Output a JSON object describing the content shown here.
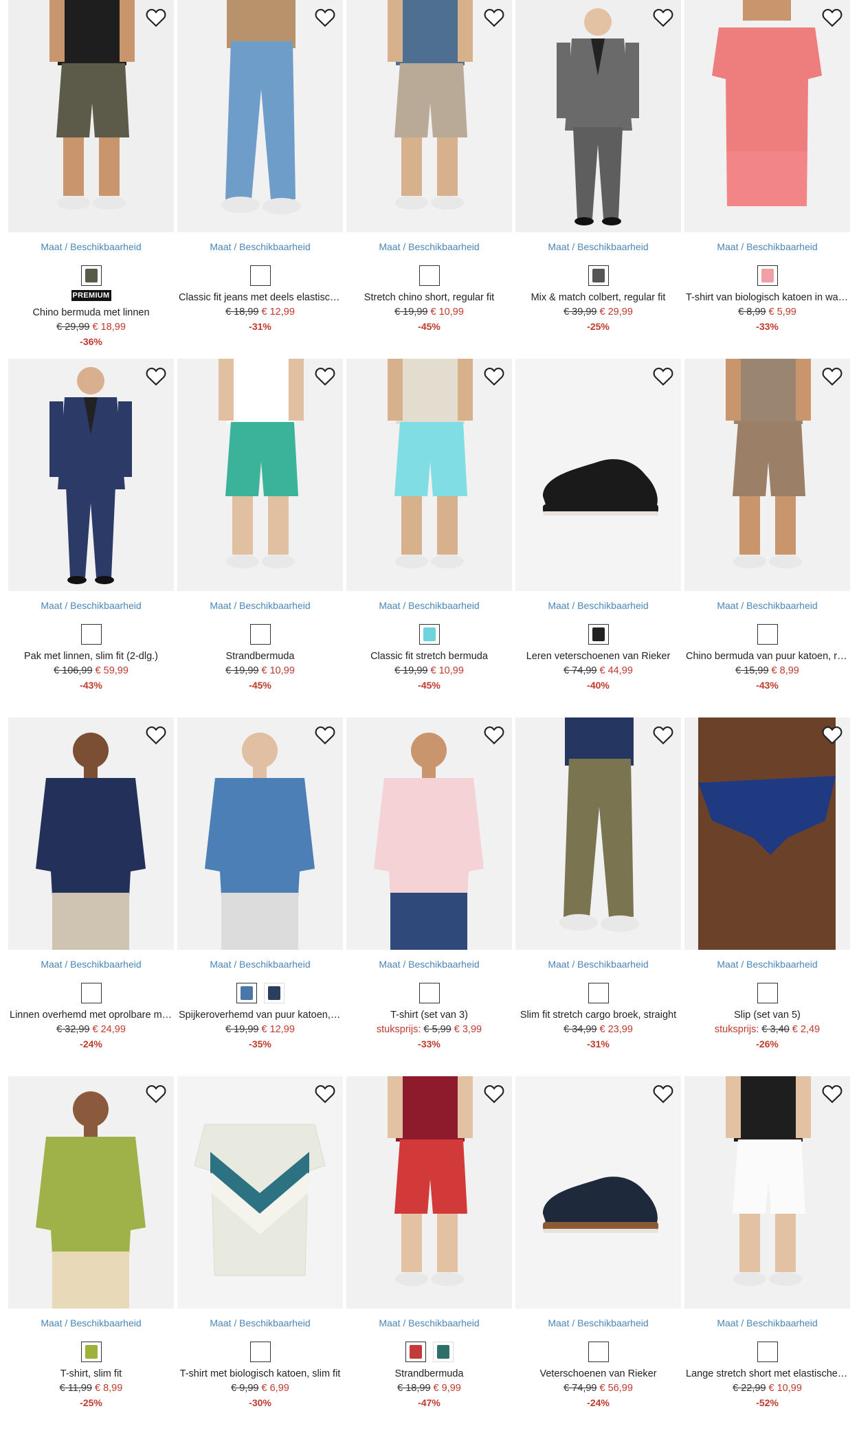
{
  "colors": {
    "link": "#4a86b8",
    "sale": "#c0392b"
  },
  "size_label": "Maat / Beschikbaarheid",
  "unit_price_label": "stuksprijs:",
  "premium_label": "PREMIUM",
  "products": [
    {
      "name": "Chino bermuda met linnen",
      "old": "€ 29,99",
      "new": "€ 18,99",
      "disc": "-36%",
      "premium": true,
      "swatches": [
        "#5a5a4a"
      ],
      "bg": "#efefef",
      "fig": "shorts",
      "top": "#1e1e1e",
      "bottom": "#5c5a48",
      "skin": "#c9956d"
    },
    {
      "name": "Classic fit jeans met deels elastische band, straight",
      "old": "€ 18,99",
      "new": "€ 12,99",
      "disc": "-31%",
      "swatches": [
        "#ffffff"
      ],
      "bg": "#f1f1f1",
      "fig": "jeans",
      "top": "#b8926a",
      "bottom": "#6f9dc9",
      "skin": "#e5c7a8"
    },
    {
      "name": "Stretch chino short, regular fit",
      "old": "€ 19,99",
      "new": "€ 10,99",
      "disc": "-45%",
      "swatches": [
        "#ffffff"
      ],
      "bg": "#f1f1f1",
      "fig": "shorts",
      "top": "#4e6f92",
      "bottom": "#b8aa97",
      "skin": "#d7b08c"
    },
    {
      "name": "Mix & match colbert, regular fit",
      "old": "€ 39,99",
      "new": "€ 29,99",
      "disc": "-25%",
      "swatches": [
        "#555555"
      ],
      "bg": "#efefef",
      "fig": "suit",
      "top": "#6a6a6a",
      "bottom": "#5e5e5e",
      "skin": "#e3c2a4"
    },
    {
      "name": "T-shirt van biologisch katoen in washed-out look",
      "old": "€ 8,99",
      "new": "€ 5,99",
      "disc": "-33%",
      "swatches": [
        "#f2a0a8"
      ],
      "bg": "#f1f1f1",
      "fig": "tee",
      "top": "#ee7d7e",
      "bottom": "#f1f1f1",
      "skin": "#c9956d"
    },
    {
      "name": "Pak met linnen, slim fit (2-dlg.)",
      "old": "€ 106,99",
      "new": "€ 59,99",
      "disc": "-43%",
      "swatches": [
        "#ffffff"
      ],
      "bg": "#f1f1f1",
      "fig": "suit",
      "top": "#2b3a66",
      "bottom": "#2b3a66",
      "skin": "#d9b08f"
    },
    {
      "name": "Strandbermuda",
      "old": "€ 19,99",
      "new": "€ 10,99",
      "disc": "-45%",
      "swatches": [
        "#ffffff"
      ],
      "bg": "#f1f1f1",
      "fig": "shorts",
      "top": "#ffffff",
      "bottom": "#3bb39a",
      "skin": "#e0c0a0"
    },
    {
      "name": "Classic fit stretch bermuda",
      "old": "€ 19,99",
      "new": "€ 10,99",
      "disc": "-45%",
      "swatches": [
        "#6fd3de"
      ],
      "bg": "#f1f1f1",
      "fig": "shorts",
      "top": "#e3ddcf",
      "bottom": "#7fdde3",
      "skin": "#d7b08c"
    },
    {
      "name": "Leren veterschoenen van Rieker",
      "old": "€ 74,99",
      "new": "€ 44,99",
      "disc": "-40%",
      "swatches": [
        "#222222"
      ],
      "bg": "#f4f4f4",
      "fig": "shoe",
      "top": "#1a1a1a",
      "bottom": "#1a1a1a",
      "skin": "#1a1a1a"
    },
    {
      "name": "Chino bermuda van puur katoen, regular fit",
      "old": "€ 15,99",
      "new": "€ 8,99",
      "disc": "-43%",
      "swatches": [
        "#ffffff"
      ],
      "bg": "#f1f1f1",
      "fig": "shorts",
      "top": "#9a8670",
      "bottom": "#9b7f66",
      "skin": "#c9956d"
    },
    {
      "name": "Linnen overhemd met oprolbare mouwen",
      "old": "€ 32,99",
      "new": "€ 24,99",
      "disc": "-24%",
      "swatches": [
        "#ffffff"
      ],
      "bg": "#f1f1f1",
      "fig": "shirt",
      "top": "#22305a",
      "bottom": "#cfc4b2",
      "skin": "#7a4f33"
    },
    {
      "name": "Spijkeroverhemd van puur katoen, slim fit",
      "old": "€ 19,99",
      "new": "€ 12,99",
      "disc": "-35%",
      "swatches": [
        "#4a77a8",
        "#2c3e5e"
      ],
      "bg": "#f1f1f1",
      "fig": "shirt",
      "top": "#4b7fb5",
      "bottom": "#dcdcdc",
      "skin": "#e0bfa2"
    },
    {
      "name": "T-shirt (set van 3)",
      "unit": true,
      "old": "€ 5,99",
      "new": "€ 3,99",
      "disc": "-33%",
      "swatches": [
        "#ffffff"
      ],
      "bg": "#f1f1f1",
      "fig": "shirt",
      "top": "#f4d2d6",
      "bottom": "#2f4a7a",
      "skin": "#c9956d"
    },
    {
      "name": "Slim fit stretch cargo broek, straight",
      "old": "€ 34,99",
      "new": "€ 23,99",
      "disc": "-31%",
      "swatches": [
        "#ffffff"
      ],
      "bg": "#f1f1f1",
      "fig": "jeans",
      "top": "#253761",
      "bottom": "#7a7451",
      "skin": "#d7b08c"
    },
    {
      "name": "Slip (set van 5)",
      "unit": true,
      "old": "€ 3,40",
      "new": "€ 2,49",
      "disc": "-26%",
      "swatches": [
        "#ffffff"
      ],
      "bg": "#f1f1f1",
      "fig": "brief",
      "top": "#6b4129",
      "bottom": "#1f3a80",
      "skin": "#6b4129"
    },
    {
      "name": "T-shirt, slim fit",
      "old": "€ 11,99",
      "new": "€ 8,99",
      "disc": "-25%",
      "swatches": [
        "#9db13b"
      ],
      "bg": "#f1f1f1",
      "fig": "shirt",
      "top": "#9fb24a",
      "bottom": "#e8d9b8",
      "skin": "#8b5a3c"
    },
    {
      "name": "T-shirt met biologisch katoen, slim fit",
      "old": "€ 9,99",
      "new": "€ 6,99",
      "disc": "-30%",
      "swatches": [
        "#ffffff"
      ],
      "bg": "#f4f4f4",
      "fig": "flat",
      "top": "#e9eadf",
      "bottom": "#2c7282",
      "skin": "#e9eadf"
    },
    {
      "name": "Strandbermuda",
      "old": "€ 18,99",
      "new": "€ 9,99",
      "disc": "-47%",
      "swatches": [
        "#c23a3a",
        "#2f6f6a"
      ],
      "bg": "#f1f1f1",
      "fig": "shorts",
      "top": "#8e1b2c",
      "bottom": "#d23a3a",
      "skin": "#e2c2a3"
    },
    {
      "name": "Veterschoenen van Rieker",
      "old": "€ 74,99",
      "new": "€ 56,99",
      "disc": "-24%",
      "swatches": [
        "#ffffff"
      ],
      "bg": "#f4f4f4",
      "fig": "shoe",
      "top": "#1e2a3c",
      "bottom": "#8a5a35",
      "skin": "#1e2a3c"
    },
    {
      "name": "Lange stretch short met elastische band",
      "old": "€ 22,99",
      "new": "€ 10,99",
      "disc": "-52%",
      "swatches": [
        "#ffffff"
      ],
      "bg": "#f1f1f1",
      "fig": "shorts",
      "top": "#1e1e1e",
      "bottom": "#fbfbfb",
      "skin": "#e2c2a3"
    }
  ]
}
